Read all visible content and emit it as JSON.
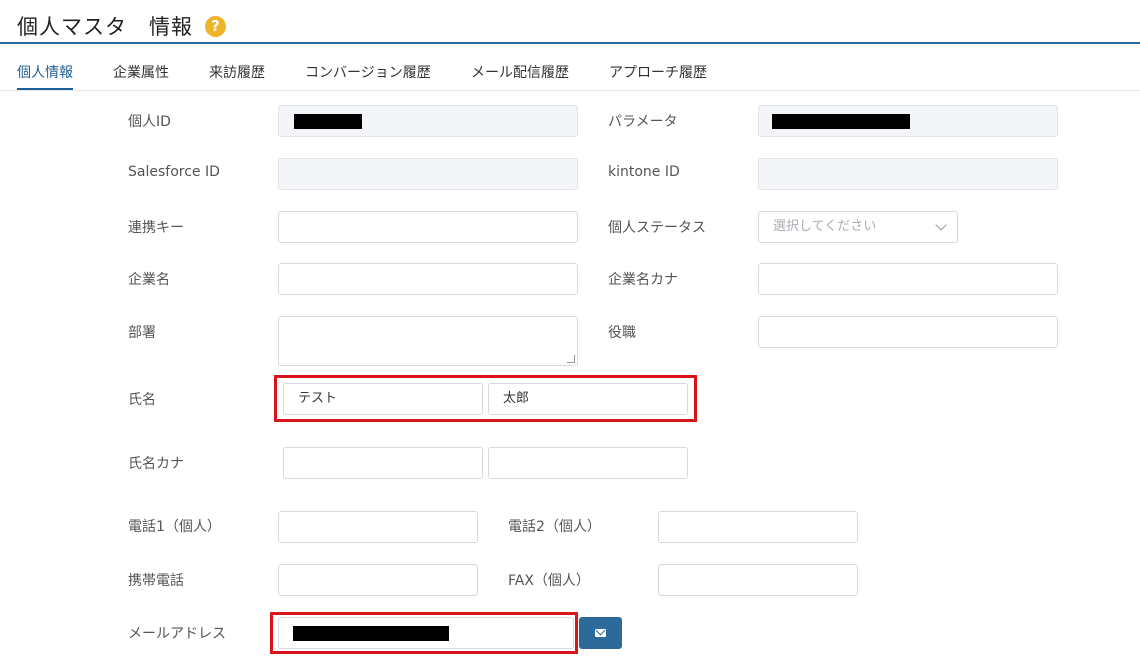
{
  "header": {
    "title": "個人マスタ　情報",
    "help_icon": "question-circle-icon"
  },
  "tabs": [
    {
      "label": "個人情報",
      "active": true
    },
    {
      "label": "企業属性"
    },
    {
      "label": "来訪履歴"
    },
    {
      "label": "コンバージョン履歴"
    },
    {
      "label": "メール配信履歴"
    },
    {
      "label": "アプローチ履歴"
    }
  ],
  "form": {
    "personal_id": {
      "label": "個人ID",
      "value": "[redacted]"
    },
    "parameter": {
      "label": "パラメータ",
      "value": "[redacted]"
    },
    "salesforce_id": {
      "label": "Salesforce ID",
      "value": ""
    },
    "kintone_id": {
      "label": "kintone ID",
      "value": ""
    },
    "link_key": {
      "label": "連携キー",
      "value": ""
    },
    "personal_status": {
      "label": "個人ステータス",
      "placeholder": "選択してください"
    },
    "company_name": {
      "label": "企業名",
      "value": ""
    },
    "company_kana": {
      "label": "企業名カナ",
      "value": ""
    },
    "department": {
      "label": "部署",
      "value": ""
    },
    "position": {
      "label": "役職",
      "value": ""
    },
    "full_name": {
      "label": "氏名",
      "last": "テスト",
      "first": "太郎"
    },
    "name_kana": {
      "label": "氏名カナ",
      "last": "",
      "first": ""
    },
    "phone1": {
      "label": "電話1（個人）",
      "value": ""
    },
    "phone2": {
      "label": "電話2（個人）",
      "value": ""
    },
    "mobile": {
      "label": "携帯電話",
      "value": ""
    },
    "fax": {
      "label": "FAX（個人）",
      "value": ""
    },
    "email": {
      "label": "メールアドレス",
      "value": "[redacted]",
      "button_icon": "envelope-icon"
    }
  },
  "colors": {
    "accent": "#2d6a9a",
    "highlight": "#d9151b",
    "help": "#f0b429"
  }
}
